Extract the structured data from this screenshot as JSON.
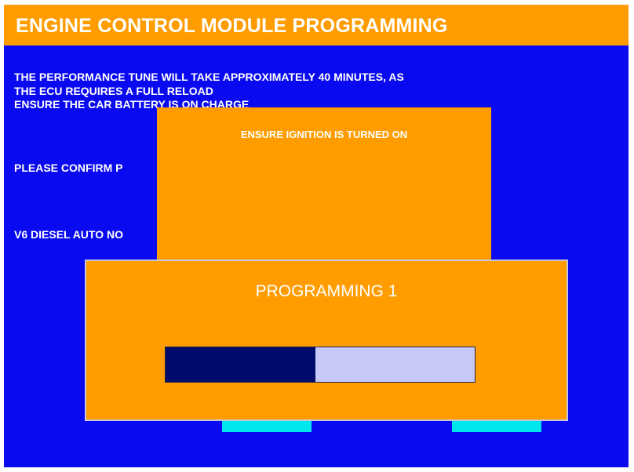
{
  "header": {
    "title": "ENGINE CONTROL MODULE PROGRAMMING"
  },
  "background_text": {
    "line1": "THE PERFORMANCE TUNE WILL TAKE APPROXIMATELY 40 MINUTES, AS",
    "line2": "THE ECU REQUIRES A FULL RELOAD",
    "line3": "ENSURE THE CAR BATTERY IS ON CHARGE",
    "confirm": "PLEASE CONFIRM P",
    "vehicle": "V6 DIESEL AUTO NO"
  },
  "notice_dialog": {
    "message": "ENSURE IGNITION IS TURNED ON"
  },
  "progress_dialog": {
    "title": "PROGRAMMING 1",
    "progress_fraction": 0.485
  },
  "colors": {
    "screen_bg": "#0a0af0",
    "accent_orange": "#ff9d00",
    "progress_fill": "#000a6a",
    "progress_track": "#c8c8f8",
    "button_cyan": "#00e6ee"
  }
}
